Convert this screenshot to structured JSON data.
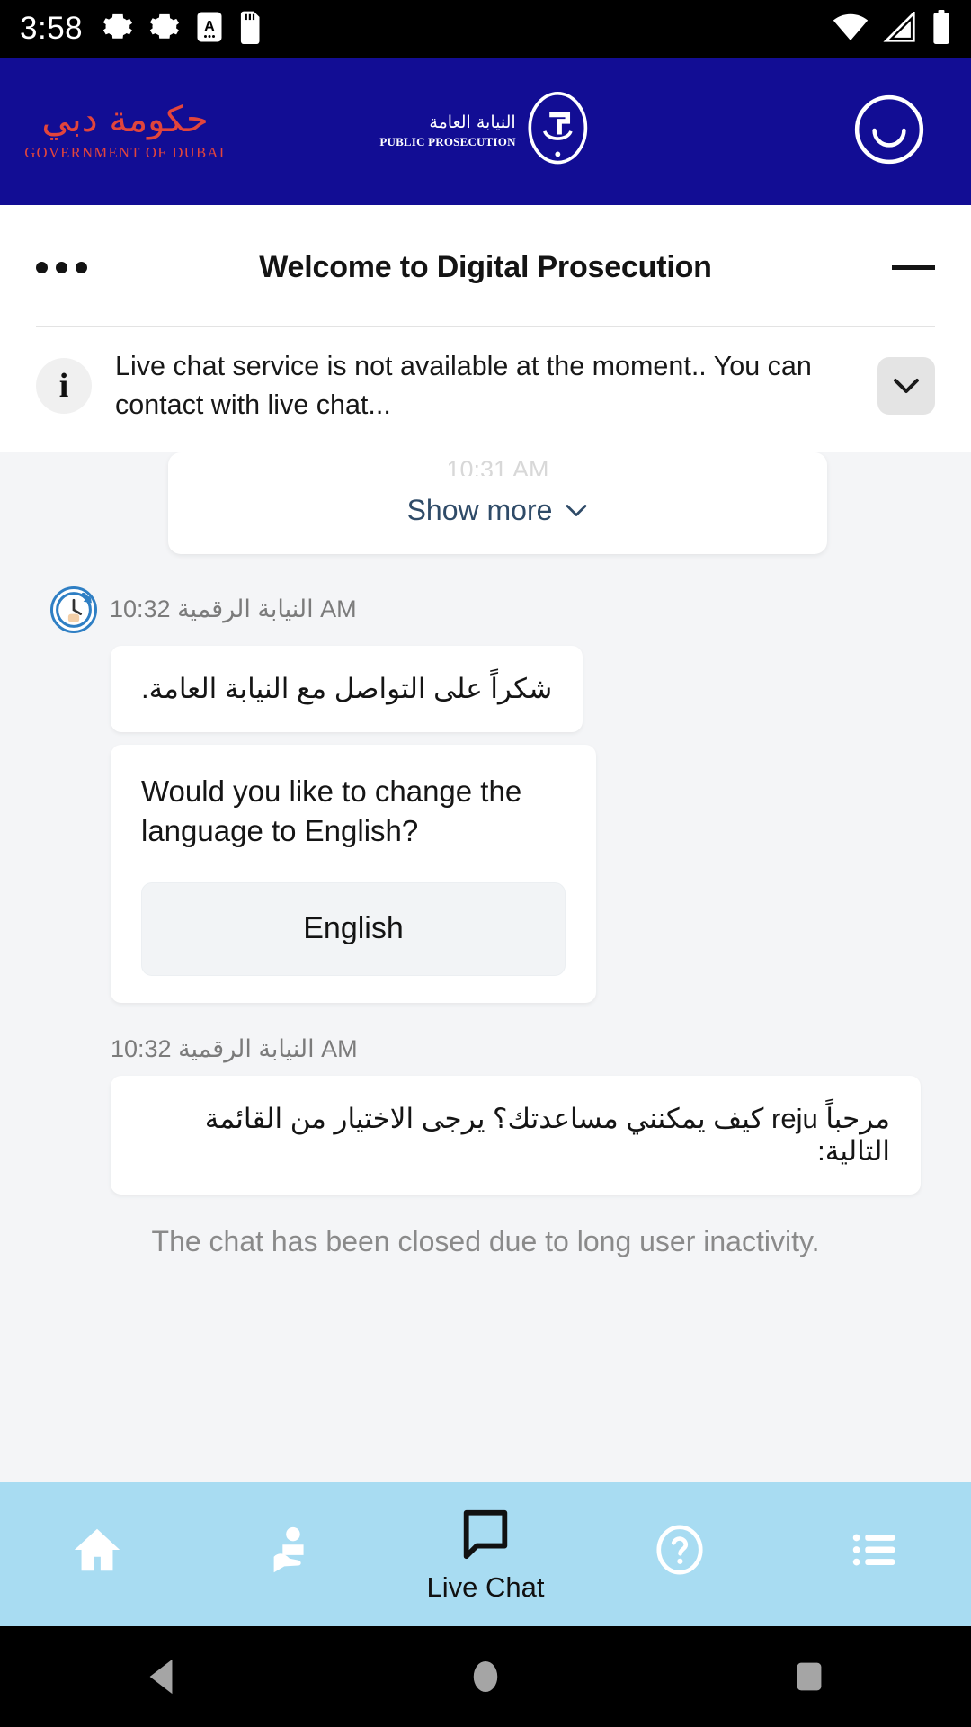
{
  "statusbar": {
    "time": "3:58",
    "left_icons": [
      "gear-icon",
      "gear-icon",
      "letter-a-badge-icon",
      "sd-card-icon"
    ],
    "right_icons": [
      "wifi-icon",
      "cellular-signal-icon",
      "battery-icon"
    ]
  },
  "brandbar": {
    "dubai_logo_arabic": "حكومة دبي",
    "dubai_logo_latin": "GOVERNMENT OF DUBAI",
    "pp_logo_arabic": "النيابة العامة",
    "pp_logo_latin": "PUBLIC PROSECUTION",
    "avatar_icon": "smiley-face-icon",
    "background_color": "#120d94",
    "dubai_logo_color": "#e2453c"
  },
  "chat_header": {
    "menu_icon": "more-options-icon",
    "title": "Welcome to Digital Prosecution",
    "minimize_icon": "minimize-icon"
  },
  "info_banner": {
    "icon": "info-icon",
    "icon_glyph": "i",
    "text": "Live chat service is not available at the moment.. You can contact with live chat...",
    "expand_icon": "chevron-down-icon"
  },
  "chat": {
    "clipped_card": {
      "ghost_text": "10:31 AM",
      "show_more_label": "Show more",
      "show_more_icon": "chevron-down-icon"
    },
    "messages": [
      {
        "avatar_icon": "clock-history-icon",
        "sender": "النيابة الرقمية",
        "time": "10:32 AM",
        "meta_line": "النيابة الرقمية 10:32 AM",
        "bubbles": [
          {
            "dir": "rtl",
            "text": "شكراً على التواصل مع النيابة العامة."
          }
        ]
      },
      {
        "bubbles": [
          {
            "dir": "ltr",
            "text": "Would you like to change the language to English?",
            "button_label": "English"
          }
        ]
      },
      {
        "sender": "النيابة الرقمية",
        "time": "10:32 AM",
        "meta_line": "النيابة الرقمية 10:32 AM",
        "bubbles": [
          {
            "dir": "rtl",
            "text": "مرحباً reju كيف يمكنني مساعدتك؟ يرجى الاختيار من القائمة التالية:"
          }
        ]
      }
    ],
    "closed_note": "The chat has been closed due to long user inactivity."
  },
  "appnav": {
    "background_color": "#a8dcf2",
    "items": [
      {
        "icon": "home-icon",
        "label": ""
      },
      {
        "icon": "services-hand-icon",
        "label": ""
      },
      {
        "icon": "chat-bubble-icon",
        "label": "Live Chat",
        "active": true
      },
      {
        "icon": "help-question-icon",
        "label": ""
      },
      {
        "icon": "list-menu-icon",
        "label": ""
      }
    ]
  },
  "sysnav": {
    "back_icon": "back-triangle-icon",
    "home_icon": "home-circle-icon",
    "recents_icon": "recents-square-icon"
  }
}
